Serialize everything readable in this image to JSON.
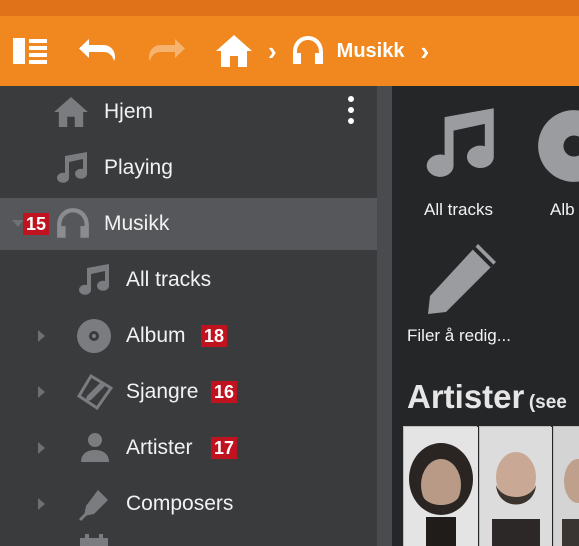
{
  "header": {
    "breadcrumb_current": "Musikk",
    "icons": [
      "sidebar-toggle-icon",
      "undo-icon",
      "redo-icon",
      "home-icon",
      "headphones-icon",
      "chevron-right-icon"
    ],
    "accent_color": "#f0881f"
  },
  "sidebar": {
    "items": [
      {
        "label": "Hjem",
        "icon": "home-icon"
      },
      {
        "label": "Playing",
        "icon": "music-note-icon"
      },
      {
        "label": "Musikk",
        "icon": "headphones-icon",
        "badge": "15",
        "selected": true,
        "expanded": true
      },
      {
        "label": "All tracks",
        "icon": "music-note-icon"
      },
      {
        "label": "Album",
        "icon": "disc-icon",
        "badge": "18"
      },
      {
        "label": "Sjangre",
        "icon": "tag-pencil-icon",
        "badge": "16"
      },
      {
        "label": "Artister",
        "icon": "person-icon",
        "badge": "17"
      },
      {
        "label": "Composers",
        "icon": "fountain-pen-icon"
      }
    ],
    "badge_color": "#c1121f"
  },
  "main": {
    "tiles": [
      {
        "label": "All tracks",
        "icon": "music-note-icon"
      },
      {
        "label": "Alb",
        "icon": "disc-icon"
      },
      {
        "label": "Filer å redig...",
        "icon": "pencil-icon"
      }
    ],
    "section_title": "Artister",
    "section_subtitle": "(see"
  }
}
